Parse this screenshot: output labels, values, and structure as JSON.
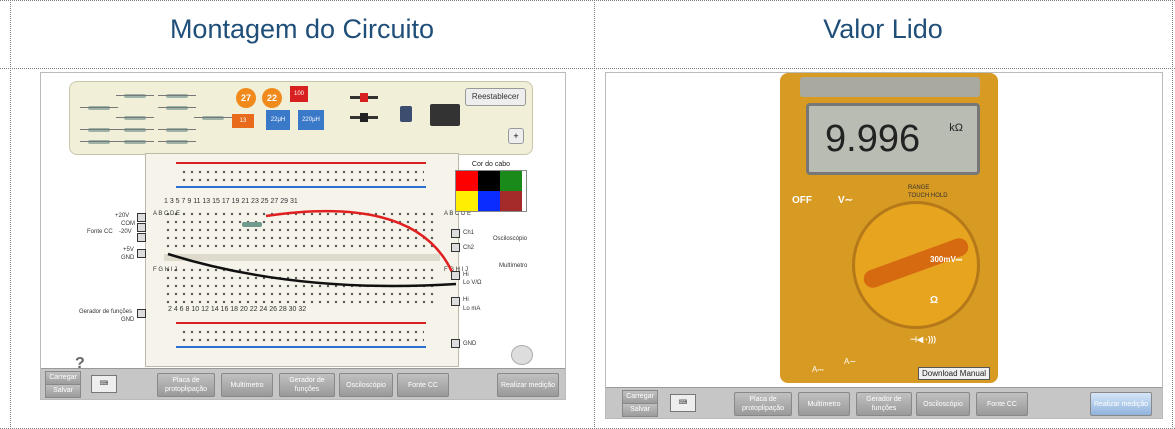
{
  "left": {
    "title": "Montagem do Circuito",
    "tray": {
      "reset_label": "Reestablecer",
      "plus_label": "+",
      "cap_values": [
        "27",
        "22",
        "100"
      ],
      "cap_value_2": "13",
      "inductors": [
        "22μH",
        "220μH"
      ]
    },
    "breadboard": {
      "top_numbers": "1   3   5   7   9  11  13  15  17  19  21  23  25  27  29  31",
      "bottom_numbers": "2   4   6   8  10  12  14  16  18  20  22  24  26  28  30  32",
      "rows_top": "A B C D E",
      "rows_bottom": "F G H I J",
      "left_labels": {
        "v20": "+20V",
        "com": "COM",
        "vneg20": "-20V",
        "fonte": "Fonte CC",
        "v5": "+5V",
        "gnd": "GND",
        "gerador": "Gerador de funções",
        "gnd2": "GND"
      },
      "right_labels": {
        "ch1": "Ch1",
        "osc": "Osciloscópio",
        "ch2": "Ch2",
        "multi": "Multímetro",
        "hi": "Hi",
        "lo_vo": "Lo V/Ω",
        "hi2": "Hi",
        "lo_ma": "Lo mA",
        "gnd": "GND"
      }
    },
    "palette": {
      "title": "Cor do cabo",
      "colors": [
        "#ff0000",
        "#000000",
        "#1a8a1a",
        "#ffee00",
        "#0a2cff",
        "#a52a2a"
      ]
    },
    "help": "?",
    "toolbar": {
      "carregar": "Carregar",
      "salvar": "Salvar",
      "kbd": "⌨",
      "placa": "Placa de protoplipação",
      "multimetro": "Multímetro",
      "gerador": "Gerador de funções",
      "osciloscopio": "Osciloscópio",
      "fonte": "Fonte CC",
      "realizar": "Realizar medição"
    }
  },
  "right": {
    "title": "Valor Lido",
    "meter": {
      "reading": "9.996",
      "unit": "kΩ",
      "off": "OFF",
      "v_ac": "V∼",
      "v_dc": "V⎓",
      "mv": "300mV⎓",
      "ohm": "Ω",
      "diode": "⊣◀ ·)))",
      "a_dc": "A⎓",
      "a_ac": "A∼",
      "range": "RANGE",
      "touch": "TOUCH HOLD",
      "download": "Download Manual"
    },
    "toolbar": {
      "carregar": "Carregar",
      "salvar": "Salvar",
      "kbd": "⌨",
      "placa": "Placa de protoplipação",
      "multimetro": "Multímetro",
      "gerador": "Gerador de funções",
      "osciloscopio": "Osciloscópio",
      "fonte": "Fonte CC",
      "realizar": "Realizar medição"
    }
  }
}
